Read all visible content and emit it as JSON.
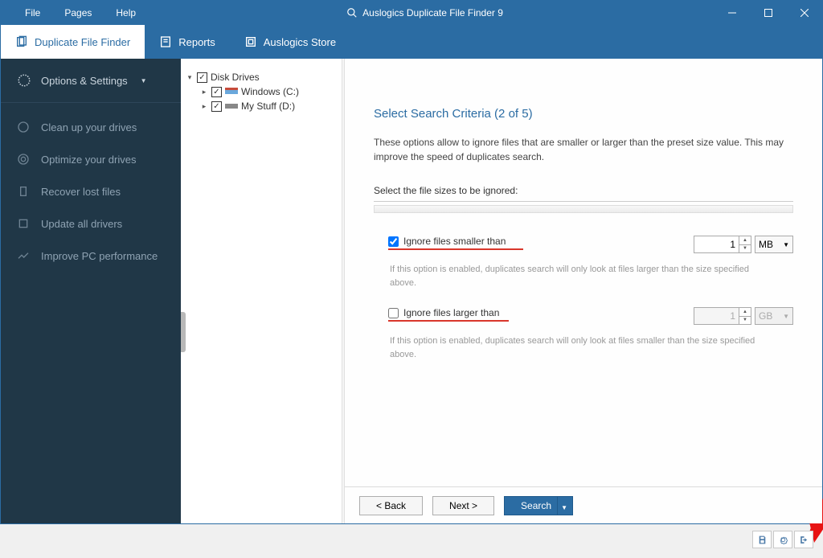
{
  "titlebar": {
    "menu": [
      "File",
      "Pages",
      "Help"
    ],
    "title": "Auslogics Duplicate File Finder 9"
  },
  "tabs": [
    {
      "label": "Duplicate File Finder",
      "active": true
    },
    {
      "label": "Reports",
      "active": false
    },
    {
      "label": "Auslogics Store",
      "active": false
    }
  ],
  "sidebar": {
    "header": "Options & Settings",
    "items": [
      "Clean up your drives",
      "Optimize your drives",
      "Recover lost files",
      "Update all drivers",
      "Improve PC performance"
    ]
  },
  "tree": {
    "root": "Disk Drives",
    "children": [
      {
        "label": "Windows (C:)"
      },
      {
        "label": "My Stuff (D:)"
      }
    ]
  },
  "main": {
    "title": "Select Search Criteria (2 of 5)",
    "desc": "These options allow to ignore files that are smaller or larger than the preset size value. This may improve the speed of duplicates search.",
    "subhead": "Select the file sizes to be ignored:",
    "smaller": {
      "label": "Ignore files smaller than",
      "desc": "If this option is enabled, duplicates search will only look at files larger than the size specified above.",
      "value": "1",
      "unit": "MB",
      "checked": true
    },
    "larger": {
      "label": "Ignore files larger than",
      "desc": "If this option is enabled, duplicates search will only look at files smaller than the size specified above.",
      "value": "1",
      "unit": "GB",
      "checked": false
    },
    "buttons": {
      "back": "< Back",
      "next": "Next >",
      "search": "Search"
    }
  }
}
